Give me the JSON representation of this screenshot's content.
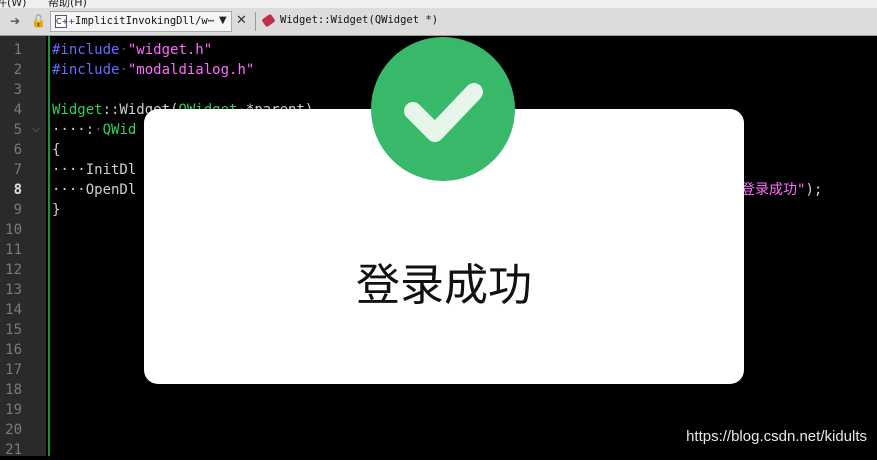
{
  "menubar": {
    "item1": "件(W)",
    "item2": "帮助(H)"
  },
  "toolbar": {
    "file_icon_text": "C++",
    "filename": "ImplicitInvokingDll/w⋯",
    "function": "Widget::Widget(QWidget *)"
  },
  "line_numbers": [
    "1",
    "2",
    "3",
    "4",
    "5",
    "6",
    "7",
    "8",
    "9",
    "10",
    "11",
    "12",
    "13",
    "14",
    "15",
    "16",
    "17",
    "18",
    "19",
    "20",
    "21"
  ],
  "code": {
    "l1_kw": "#include",
    "l1_str": "\"widget.h\"",
    "l2_kw": "#include",
    "l2_str": "\"modaldialog.h\"",
    "l4_a": "Widget",
    "l4_b": "::Widget(",
    "l4_c": "QWidget",
    "l4_d": "*parent)",
    "l5_a": "····:",
    "l5_b": "QWid",
    "l6": "{",
    "l7_a": "····InitDl",
    "l8_a": "····OpenDl",
    "l8_str": "登录成功\"",
    "l8_end": ");",
    "l9": "}"
  },
  "dialog": {
    "message": "登录成功"
  },
  "colors": {
    "accent": "#38b96a",
    "keyword": "#6b6bff",
    "string": "#ff6bff",
    "class": "#2fd05a"
  },
  "watermark": "https://blog.csdn.net/kidults"
}
